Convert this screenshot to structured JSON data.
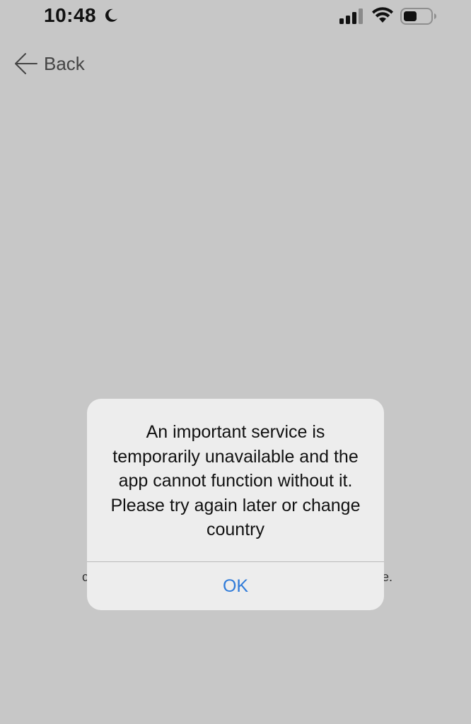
{
  "status_bar": {
    "time": "10:48",
    "icons": [
      "moon-icon",
      "cellular-signal-icon",
      "wifi-icon",
      "battery-icon"
    ]
  },
  "nav": {
    "back_label": "Back",
    "back_icon": "back-arrow-icon"
  },
  "background": {
    "left_fragment": "c",
    "right_fragment": "e."
  },
  "alert": {
    "message": "An important service is temporarily unavailable and the app cannot function without it. Please try again later or change country",
    "ok_label": "OK"
  },
  "colors": {
    "background": "#c7c7c7",
    "alert_background": "#ededed",
    "action_blue": "#2f7bd9"
  }
}
